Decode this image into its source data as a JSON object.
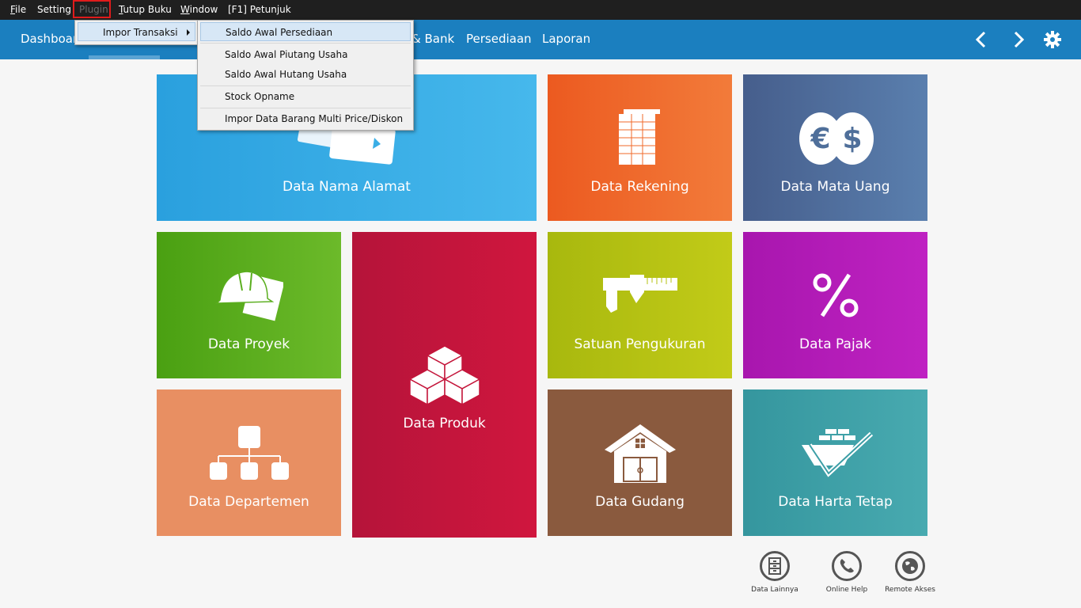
{
  "menubar": {
    "file": "File",
    "setting": "Setting",
    "plugin": "Plugin",
    "tutup_buku": "Tutup Buku",
    "window": "Window",
    "petunjuk": "[F1] Petunjuk"
  },
  "navbar": {
    "dashboard": "Dashboard",
    "kas_bank_partial": "& Bank",
    "persediaan": "Persediaan",
    "laporan": "Laporan"
  },
  "plugin_menu": {
    "impor_transaksi": "Impor Transaksi"
  },
  "submenu": {
    "items": [
      "Saldo Awal Persediaan",
      "Saldo Awal Piutang Usaha",
      "Saldo Awal Hutang Usaha",
      "Stock Opname",
      "Impor Data Barang Multi Price/Diskon"
    ]
  },
  "tiles": {
    "nama_alamat": "Data Nama Alamat",
    "rekening": "Data Rekening",
    "mata_uang": "Data Mata Uang",
    "proyek": "Data Proyek",
    "produk": "Data Produk",
    "satuan": "Satuan Pengukuran",
    "pajak": "Data Pajak",
    "departemen": "Data Departemen",
    "gudang": "Data Gudang",
    "harta_tetap": "Data Harta Tetap"
  },
  "footer": {
    "data_lainnya": "Data Lainnya",
    "online_help": "Online Help",
    "remote_akses": "Remote Akses"
  },
  "colors": {
    "menubar": "#1f1f1f",
    "navbar": "#1b7fbf",
    "nama_alamat": "#3aaee6",
    "rekening": "#f06a2a",
    "mata_uang": "#4f6f9a",
    "proyek": "#5aae1e",
    "produk": "#c4153a",
    "satuan": "#b5c112",
    "pajak": "#b51cb8",
    "departemen": "#e88a5a",
    "gudang": "#8a5a3e",
    "harta_tetap": "#3c9ea6"
  }
}
